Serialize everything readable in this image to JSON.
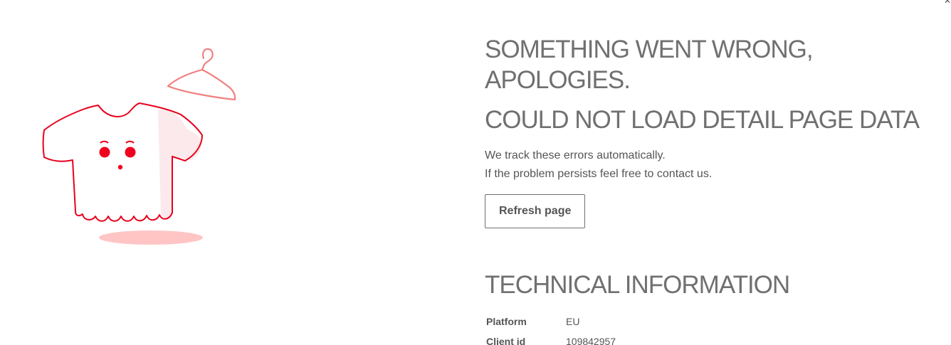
{
  "illustration": {
    "name": "sad-tshirt-with-hanger",
    "colors": {
      "shirt_outline": "#e8001c",
      "hanger": "#f08080",
      "shadow": "#ffc5c5",
      "shirt_shading": "#fbe9ec"
    }
  },
  "error": {
    "title": "SOMETHING WENT WRONG, APOLOGIES.",
    "subtitle": "COULD NOT LOAD DETAIL PAGE DATA",
    "message_line1": "We track these errors automatically.",
    "message_line2": "If the problem persists feel free to contact us.",
    "refresh_label": "Refresh page"
  },
  "technical": {
    "title": "TECHNICAL INFORMATION",
    "rows": [
      {
        "key": "Platform",
        "value": "EU"
      },
      {
        "key": "Client id",
        "value": "109842957"
      }
    ]
  }
}
